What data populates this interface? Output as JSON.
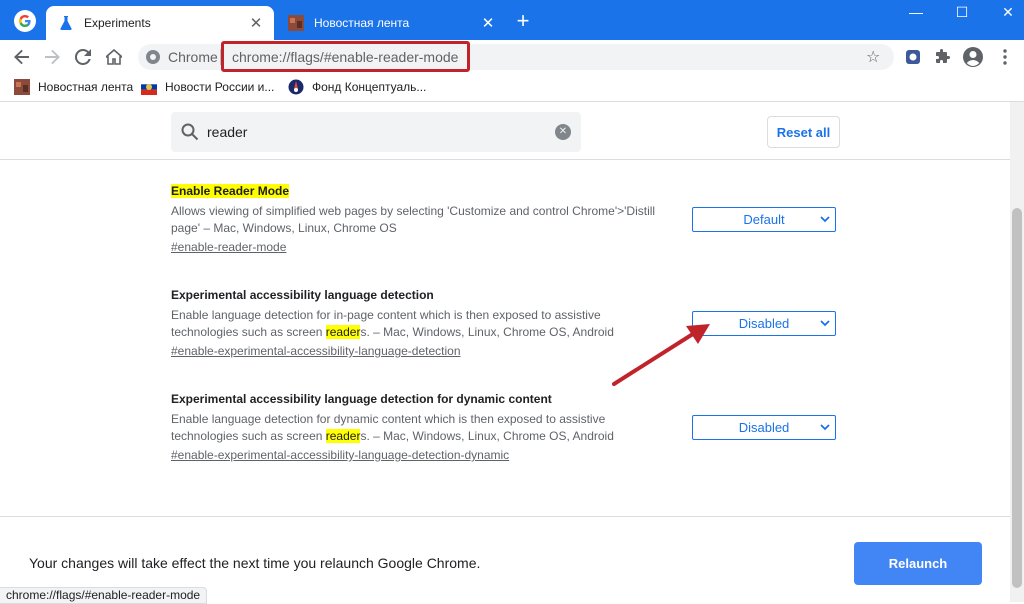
{
  "tabs": [
    {
      "title": "Experiments",
      "active": true
    },
    {
      "title": "Новостная лента",
      "active": false
    }
  ],
  "omnibox": {
    "site_label": "Chrome",
    "url": "chrome://flags/#enable-reader-mode"
  },
  "bookmarks": [
    {
      "label": "Новостная лента"
    },
    {
      "label": "Новости России и..."
    },
    {
      "label": "Фонд Концептуаль..."
    }
  ],
  "search": {
    "value": "reader",
    "reset_label": "Reset all"
  },
  "flags": [
    {
      "title": "Enable Reader Mode",
      "desc_line1": "Allows viewing of simplified web pages by selecting 'Customize and control Chrome'>'Distill",
      "desc_line2": "page' – Mac, Windows, Linux, Chrome OS",
      "link": "#enable-reader-mode",
      "value": "Default"
    },
    {
      "title": "Experimental accessibility language detection",
      "desc_line1": "Enable language detection for in-page content which is then exposed to assistive",
      "desc_pre": "technologies such as screen ",
      "desc_hl": "reader",
      "desc_post": "s. – Mac, Windows, Linux, Chrome OS, Android",
      "link": "#enable-experimental-accessibility-language-detection",
      "value": "Disabled"
    },
    {
      "title": "Experimental accessibility language detection for dynamic content",
      "desc_line1": "Enable language detection for dynamic content which is then exposed to assistive",
      "desc_pre": "technologies such as screen ",
      "desc_hl": "reader",
      "desc_post": "s. – Mac, Windows, Linux, Chrome OS, Android",
      "link": "#enable-experimental-accessibility-language-detection-dynamic",
      "value": "Disabled"
    }
  ],
  "footer": {
    "message": "Your changes will take effect the next time you relaunch Google Chrome.",
    "relaunch_label": "Relaunch"
  },
  "status_bar": {
    "url": "chrome://flags/#enable-reader-mode"
  },
  "colors": {
    "accent": "#1a73e8",
    "highlight": "#ffff00",
    "annotation": "#c1232b",
    "relaunch": "#4285f4"
  }
}
